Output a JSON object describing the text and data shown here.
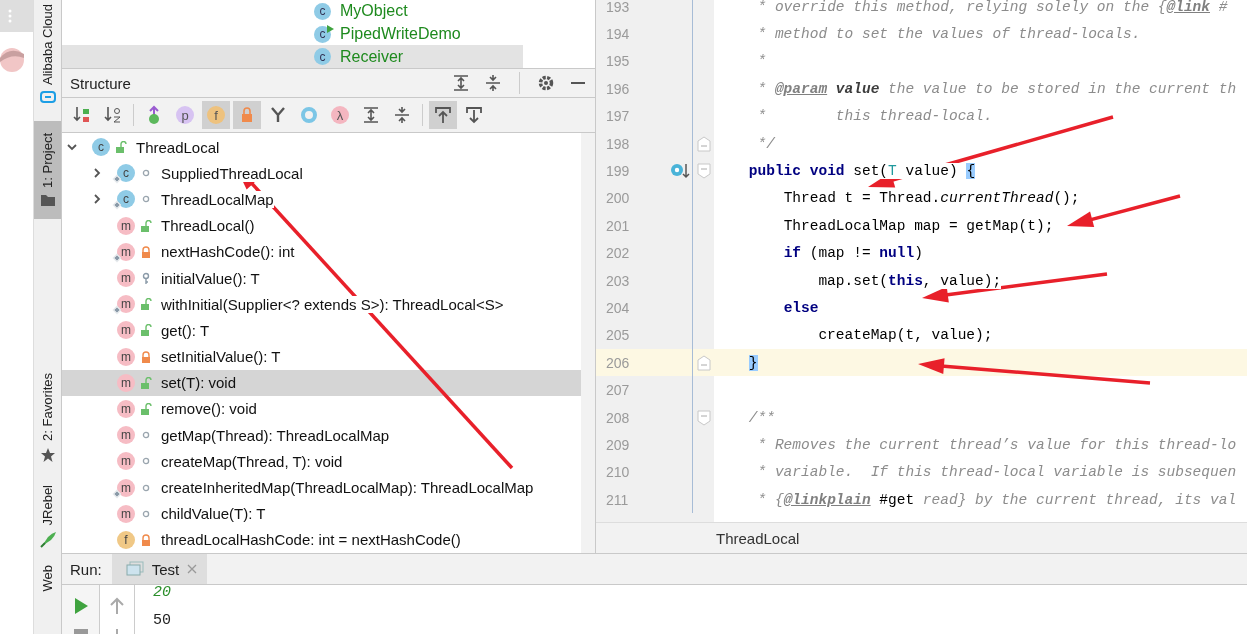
{
  "side_strip": {
    "tools": [
      {
        "label": "Alibaba Cloud",
        "selected": false
      },
      {
        "label": "1: Project",
        "selected": true
      },
      {
        "label": "2: Favorites",
        "selected": false
      },
      {
        "label": "JRebel",
        "selected": false
      },
      {
        "label": "Web",
        "selected": false
      }
    ]
  },
  "project_tree": {
    "items": [
      {
        "name": "MyObject",
        "badge": "c",
        "runnable": false,
        "selected": false
      },
      {
        "name": "PipedWriteDemo",
        "badge": "c",
        "runnable": true,
        "selected": false
      },
      {
        "name": "Receiver",
        "badge": "c",
        "runnable": false,
        "selected": true
      }
    ]
  },
  "structure": {
    "title": "Structure",
    "toolbar": [
      {
        "kind": "sort-visibility",
        "selected": false
      },
      {
        "kind": "sort-alpha",
        "selected": false
      },
      {
        "kind": "inherited",
        "selected": false
      },
      {
        "kind": "letter",
        "glyph": "p",
        "color": "#d7c3f2",
        "selected": false
      },
      {
        "kind": "letter",
        "glyph": "f",
        "color": "#eec27e",
        "selected": true
      },
      {
        "kind": "lock",
        "selected": true
      },
      {
        "kind": "fork",
        "selected": false
      },
      {
        "kind": "ring",
        "selected": false
      },
      {
        "kind": "letter",
        "glyph": "λ",
        "color": "#f4b6c0",
        "selected": false
      },
      {
        "kind": "expand",
        "selected": false
      },
      {
        "kind": "collapse",
        "selected": false
      },
      {
        "kind": "scroll-to",
        "selected": true
      },
      {
        "kind": "scroll-from",
        "selected": false
      }
    ],
    "tree": [
      {
        "name": "ThreadLocal",
        "kind": "class",
        "badge": "c",
        "modifier": {
          "kind": "public"
        },
        "static": false,
        "expanded": true,
        "selected": false,
        "children": [
          {
            "name": "SuppliedThreadLocal",
            "kind": "class",
            "badge": "c",
            "modifier": {
              "kind": "package"
            },
            "static": true,
            "expanded": false,
            "selected": false
          },
          {
            "name": "ThreadLocalMap",
            "kind": "class",
            "badge": "c",
            "modifier": {
              "kind": "package"
            },
            "static": true,
            "expanded": false,
            "selected": false
          },
          {
            "name": "ThreadLocal()",
            "kind": "method",
            "badge": "m",
            "modifier": {
              "kind": "public"
            },
            "static": false,
            "selected": false
          },
          {
            "name": "nextHashCode(): int",
            "kind": "method",
            "badge": "m",
            "modifier": {
              "kind": "private"
            },
            "static": true,
            "selected": false
          },
          {
            "name": "initialValue(): T",
            "kind": "method",
            "badge": "m",
            "modifier": {
              "kind": "protected"
            },
            "static": false,
            "selected": false
          },
          {
            "name": "withInitial(Supplier<? extends S>): ThreadLocal<S>",
            "kind": "method",
            "badge": "m",
            "modifier": {
              "kind": "public"
            },
            "static": true,
            "selected": false
          },
          {
            "name": "get(): T",
            "kind": "method",
            "badge": "m",
            "modifier": {
              "kind": "public"
            },
            "static": false,
            "selected": false
          },
          {
            "name": "setInitialValue(): T",
            "kind": "method",
            "badge": "m",
            "modifier": {
              "kind": "private"
            },
            "static": false,
            "selected": false
          },
          {
            "name": "set(T): void",
            "kind": "method",
            "badge": "m",
            "modifier": {
              "kind": "public"
            },
            "static": false,
            "selected": true
          },
          {
            "name": "remove(): void",
            "kind": "method",
            "badge": "m",
            "modifier": {
              "kind": "public"
            },
            "static": false,
            "selected": false
          },
          {
            "name": "getMap(Thread): ThreadLocalMap",
            "kind": "method",
            "badge": "m",
            "modifier": {
              "kind": "package"
            },
            "static": false,
            "selected": false
          },
          {
            "name": "createMap(Thread, T): void",
            "kind": "method",
            "badge": "m",
            "modifier": {
              "kind": "package"
            },
            "static": false,
            "selected": false
          },
          {
            "name": "createInheritedMap(ThreadLocalMap): ThreadLocalMap",
            "kind": "method",
            "badge": "m",
            "modifier": {
              "kind": "package"
            },
            "static": true,
            "selected": false
          },
          {
            "name": "childValue(T): T",
            "kind": "method",
            "badge": "m",
            "modifier": {
              "kind": "package"
            },
            "static": false,
            "selected": false
          },
          {
            "name": "threadLocalHashCode: int = nextHashCode()",
            "kind": "field",
            "badge": "f",
            "modifier": {
              "kind": "private"
            },
            "static": false,
            "selected": false
          }
        ]
      }
    ]
  },
  "editor": {
    "lines": [
      {
        "number": "193",
        "current": false,
        "segments": [
          {
            "t": "     * override this method, relying solely on the {",
            "kind": "doc"
          },
          {
            "t": "@link",
            "kind": "doc-tag"
          },
          {
            "t": " #",
            "kind": "doc"
          }
        ]
      },
      {
        "number": "194",
        "current": false,
        "segments": [
          {
            "t": "     * method to set the values of thread-locals.",
            "kind": "doc"
          }
        ]
      },
      {
        "number": "195",
        "current": false,
        "segments": [
          {
            "t": "     *",
            "kind": "doc"
          }
        ]
      },
      {
        "number": "196",
        "current": false,
        "segments": [
          {
            "t": "     * ",
            "kind": "doc"
          },
          {
            "t": "@param",
            "kind": "doc-tag"
          },
          {
            "t": " value",
            "kind": "doc-bold"
          },
          {
            "t": " the value to be stored in the current th",
            "kind": "doc"
          }
        ]
      },
      {
        "number": "197",
        "current": false,
        "segments": [
          {
            "t": "     *        this thread-local.",
            "kind": "doc"
          }
        ]
      },
      {
        "number": "198",
        "current": false,
        "fold": {
          "kind": "end"
        },
        "segments": [
          {
            "t": "     */",
            "kind": "doc"
          }
        ]
      },
      {
        "number": "199",
        "current": false,
        "fold": {
          "kind": "start"
        },
        "marker": {
          "kind": "override"
        },
        "segments": [
          {
            "t": "    public void",
            "kind": "keyword"
          },
          {
            "t": " set(",
            "kind": "plain"
          },
          {
            "t": "T",
            "kind": "type-param"
          },
          {
            "t": " value) ",
            "kind": "plain"
          },
          {
            "t": "{",
            "kind": "brace-match"
          }
        ]
      },
      {
        "number": "200",
        "current": false,
        "segments": [
          {
            "t": "        Thread t = Thread.",
            "kind": "plain"
          },
          {
            "t": "currentThread",
            "kind": "italic"
          },
          {
            "t": "();",
            "kind": "plain"
          }
        ]
      },
      {
        "number": "201",
        "current": false,
        "segments": [
          {
            "t": "        ThreadLocalMap map = getMap(t);",
            "kind": "plain"
          }
        ]
      },
      {
        "number": "202",
        "current": false,
        "segments": [
          {
            "t": "        if",
            "kind": "keyword"
          },
          {
            "t": " (map != ",
            "kind": "plain"
          },
          {
            "t": "null",
            "kind": "keyword"
          },
          {
            "t": ")",
            "kind": "plain"
          }
        ]
      },
      {
        "number": "203",
        "current": false,
        "segments": [
          {
            "t": "            map.set(",
            "kind": "plain"
          },
          {
            "t": "this",
            "kind": "keyword"
          },
          {
            "t": ", value);",
            "kind": "plain"
          }
        ]
      },
      {
        "number": "204",
        "current": false,
        "segments": [
          {
            "t": "        else",
            "kind": "keyword"
          }
        ]
      },
      {
        "number": "205",
        "current": false,
        "segments": [
          {
            "t": "            createMap(t, value);",
            "kind": "plain"
          }
        ]
      },
      {
        "number": "206",
        "current": true,
        "fold": {
          "kind": "end"
        },
        "segments": [
          {
            "t": "    }",
            "kind": "brace-match"
          }
        ]
      },
      {
        "number": "207",
        "current": false
      },
      {
        "number": "208",
        "current": false,
        "fold": {
          "kind": "start"
        },
        "segments": [
          {
            "t": "    /**",
            "kind": "doc"
          }
        ]
      },
      {
        "number": "209",
        "current": false,
        "segments": [
          {
            "t": "     * Removes the current thread’s value for this thread-lo",
            "kind": "doc"
          }
        ]
      },
      {
        "number": "210",
        "current": false,
        "segments": [
          {
            "t": "     * variable.  If this thread-local variable is subsequen",
            "kind": "doc"
          }
        ]
      },
      {
        "number": "211",
        "current": false,
        "segments": [
          {
            "t": "     * {",
            "kind": "doc"
          },
          {
            "t": "@linkplain",
            "kind": "doc-tag"
          },
          {
            "t": " #get",
            "kind": "doc-code"
          },
          {
            "t": " read} by the current thread, its val",
            "kind": "doc"
          }
        ]
      }
    ],
    "breadcrumb": "ThreadLocal"
  },
  "run": {
    "label": "Run:",
    "tabs": [
      {
        "label": "Test",
        "selected": true
      }
    ],
    "output": [
      {
        "text": "20",
        "kind": "input"
      },
      {
        "text": "50",
        "kind": "output"
      }
    ]
  }
}
